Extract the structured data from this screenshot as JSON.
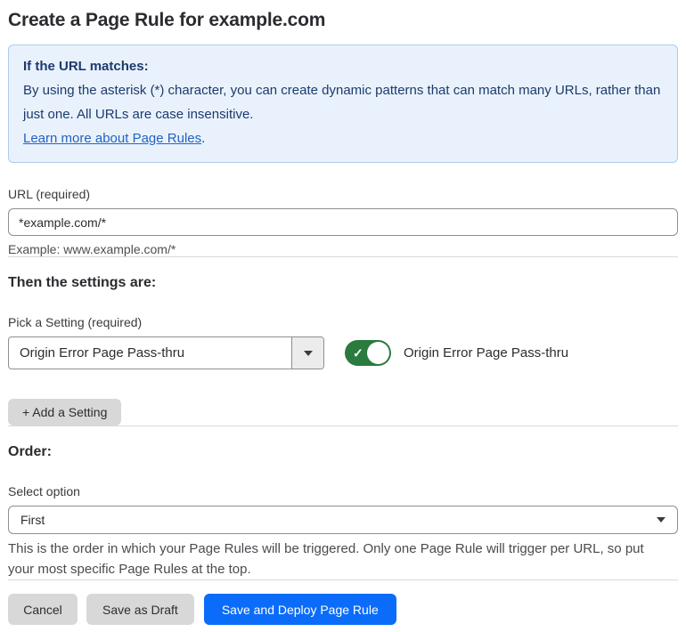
{
  "page": {
    "title": "Create a Page Rule for example.com"
  },
  "info_box": {
    "heading": "If the URL matches:",
    "body": "By using the asterisk (*) character, you can create dynamic patterns that can match many URLs, rather than just one. All URLs are case insensitive.",
    "link_text": "Learn more about Page Rules",
    "link_suffix": "."
  },
  "url_field": {
    "label": "URL (required)",
    "value": "*example.com/*",
    "helper": "Example: www.example.com/*"
  },
  "settings_section": {
    "heading": "Then the settings are:",
    "picker_label": "Pick a Setting (required)",
    "picker_value": "Origin Error Page Pass-thru",
    "toggle_state": "on",
    "toggle_check_glyph": "✓",
    "toggle_label": "Origin Error Page Pass-thru",
    "add_setting_label": "+ Add a Setting"
  },
  "order_section": {
    "heading": "Order:",
    "select_label": "Select option",
    "select_value": "First",
    "helper": "This is the order in which your Page Rules will be triggered. Only one Page Rule will trigger per URL, so put your most specific Page Rules at the top."
  },
  "actions": {
    "cancel_label": "Cancel",
    "save_draft_label": "Save as Draft",
    "save_deploy_label": "Save and Deploy Page Rule"
  },
  "colors": {
    "info_box_bg": "#e9f2fc",
    "info_box_border": "#abccee",
    "info_text": "#1d3a6d",
    "link_blue": "#2262c4",
    "toggle_green": "#2b7a3e",
    "primary_blue": "#0b6cf9",
    "secondary_button_gray": "#d8d8d8"
  }
}
